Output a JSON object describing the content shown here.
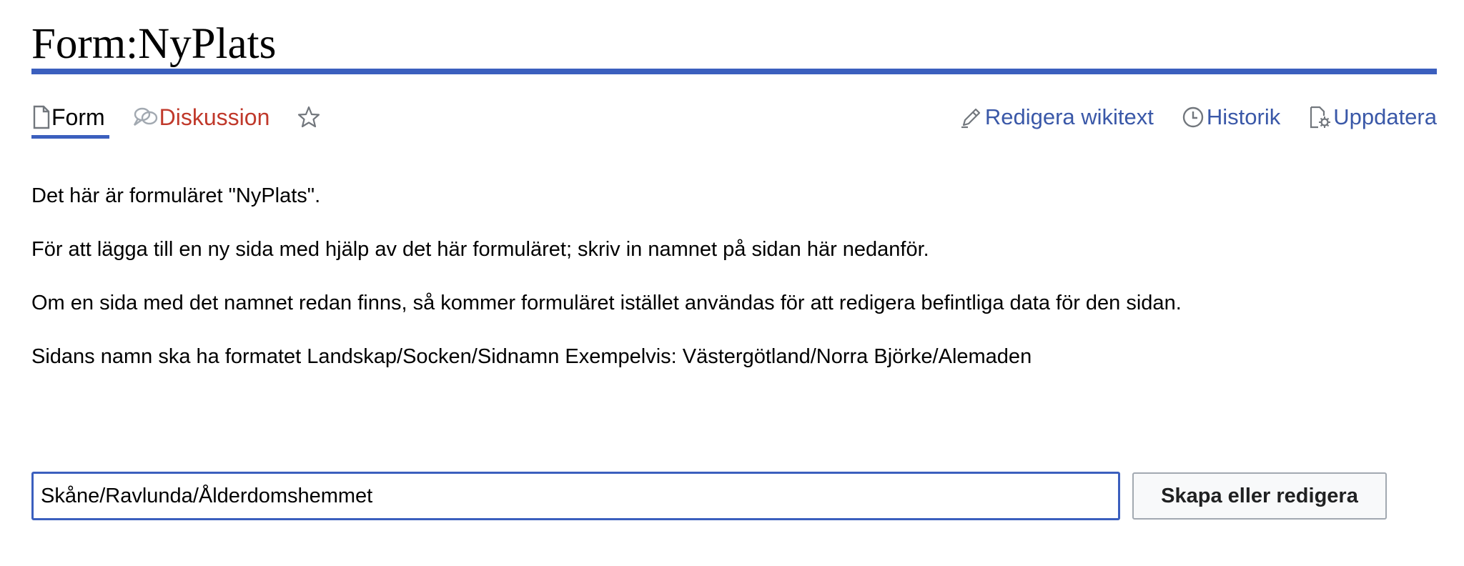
{
  "page": {
    "title": "Form:NyPlats"
  },
  "tabs": {
    "form_label": "Form",
    "discussion_label": "Diskussion",
    "watch_icon": "star-icon"
  },
  "actions": {
    "edit_label": "Redigera wikitext",
    "history_label": "Historik",
    "purge_label": "Uppdatera"
  },
  "content": {
    "paragraphs": [
      "Det här är formuläret \"NyPlats\".",
      "För att lägga till en ny sida med hjälp av det här formuläret; skriv in namnet på sidan här nedanför.",
      "Om en sida med det namnet redan finns, så kommer formuläret istället användas för att redigera befintliga data för den sidan.",
      "Sidans namn ska ha formatet Landskap/Socken/Sidnamn Exempelvis: Västergötland/Norra Björke/Alemaden"
    ]
  },
  "create_form": {
    "input_value": "Skåne/Ravlunda/Ålderdomshemmet",
    "button_label": "Skapa eller redigera"
  },
  "colors": {
    "accent": "#3b5fbe",
    "link": "#3a58a8",
    "redlink": "#c0392b"
  }
}
